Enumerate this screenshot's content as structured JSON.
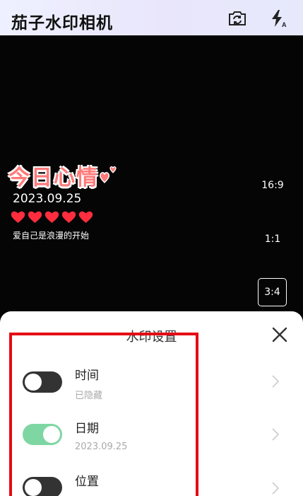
{
  "header": {
    "title": "茄子水印相机",
    "icons": [
      "camera-switch-icon",
      "flash-auto-icon"
    ]
  },
  "watermark": {
    "title": "今日心情",
    "date": "2023.09.25",
    "heart_count": 5,
    "caption": "爱自己是浪漫的开始",
    "accent_color": "#ff7a7a"
  },
  "ratios": [
    {
      "label": "16:9",
      "selected": false
    },
    {
      "label": "1:1",
      "selected": false
    },
    {
      "label": "3:4",
      "selected": true
    }
  ],
  "settings_sheet": {
    "title": "水印设置",
    "rows": [
      {
        "label": "时间",
        "sub": "已隐藏",
        "enabled": false
      },
      {
        "label": "日期",
        "sub": "2023.09.25",
        "enabled": true
      },
      {
        "label": "位置",
        "sub": "",
        "enabled": false
      }
    ]
  },
  "colors": {
    "toggle_on": "#7ed7a3",
    "toggle_off": "#333333",
    "highlight": "#e50914"
  }
}
